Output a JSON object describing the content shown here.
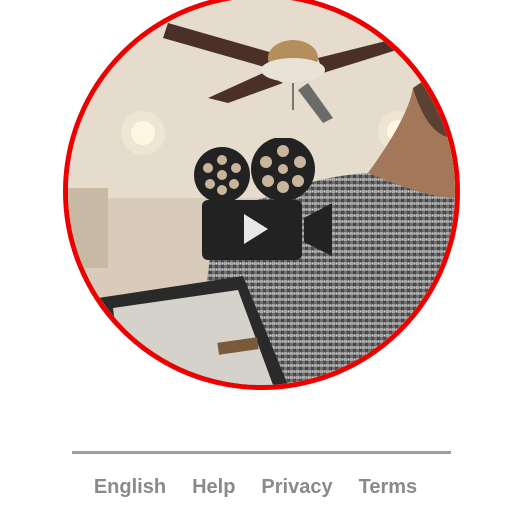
{
  "video": {
    "icon": "film-camera-play-icon",
    "border_color": "#ee0000"
  },
  "footer": {
    "links": [
      {
        "label": "English"
      },
      {
        "label": "Help"
      },
      {
        "label": "Privacy"
      },
      {
        "label": "Terms"
      }
    ],
    "link_color": "#8a8a8a",
    "divider_color": "#9e9e9e"
  }
}
